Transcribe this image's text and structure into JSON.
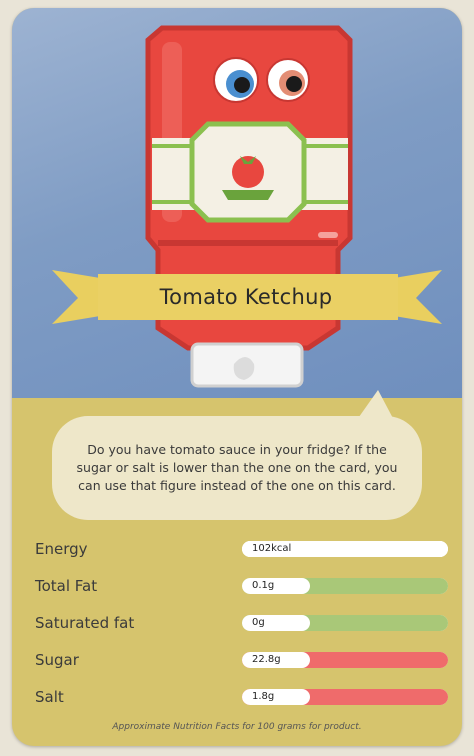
{
  "product": {
    "name": "Tomato Ketchup"
  },
  "message": "Do you have tomato sauce in your fridge? If the sugar or salt is lower than the one on the card, you can use that figure instead of the one on this card.",
  "colors": {
    "card_background": "#d6c46d",
    "sky": "#7f9cc4",
    "bottle_red": "#e8473f",
    "banner_yellow": "#e9cf5f",
    "level_green": "#a9c878",
    "level_red": "#ef6b6b"
  },
  "nutrition": {
    "rows": [
      {
        "label": "Energy",
        "value": "102kcal",
        "level": "none",
        "color": "#ffffff"
      },
      {
        "label": "Total Fat",
        "value": "0.1g",
        "level": "low",
        "color": "#a9c878"
      },
      {
        "label": "Saturated fat",
        "value": "0g",
        "level": "low",
        "color": "#a9c878"
      },
      {
        "label": "Sugar",
        "value": "22.8g",
        "level": "high",
        "color": "#ef6b6b"
      },
      {
        "label": "Salt",
        "value": "1.8g",
        "level": "high",
        "color": "#ef6b6b"
      }
    ]
  },
  "footnote": "Approximate Nutrition Facts for 100 grams for product."
}
